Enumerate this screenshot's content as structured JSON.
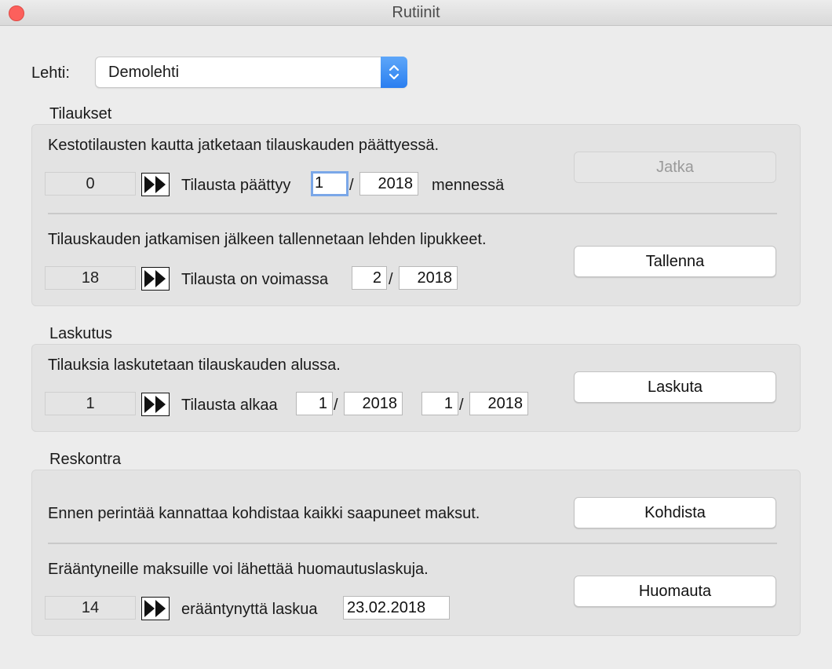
{
  "window": {
    "title": "Rutiinit"
  },
  "lehti": {
    "label": "Lehti:",
    "selected": "Demolehti"
  },
  "tilaukset": {
    "title": "Tilaukset",
    "row1": {
      "description": "Kestotilausten kautta jatketaan tilauskauden päättyessä.",
      "count": "0",
      "label": "Tilausta päättyy",
      "period": "1",
      "year": "2018",
      "suffix": "mennessä",
      "button": "Jatka"
    },
    "row2": {
      "description": "Tilauskauden jatkamisen jälkeen tallennetaan lehden lipukkeet.",
      "count": "18",
      "label": "Tilausta on voimassa",
      "period": "2",
      "year": "2018",
      "button": "Tallenna"
    }
  },
  "laskutus": {
    "title": "Laskutus",
    "description": "Tilauksia laskutetaan tilauskauden alussa.",
    "count": "1",
    "label": "Tilausta alkaa",
    "from_period": "1",
    "from_year": "2018",
    "to_period": "1",
    "to_year": "2018",
    "button": "Laskuta"
  },
  "reskontra": {
    "title": "Reskontra",
    "row1": {
      "description": "Ennen perintää kannattaa kohdistaa kaikki saapuneet maksut.",
      "button": "Kohdista"
    },
    "row2": {
      "description": "Erääntyneille maksuille voi lähettää huomautuslaskuja.",
      "count": "14",
      "label": "erääntynyttä laskua",
      "date": "23.02.2018",
      "button": "Huomauta"
    }
  },
  "colors": {
    "close": "#fc605c",
    "accent": "#2a7ef0",
    "focus": "#7aa7e8"
  },
  "icons": {
    "run": "fast-forward-icon",
    "select": "chevron-updown-icon"
  }
}
